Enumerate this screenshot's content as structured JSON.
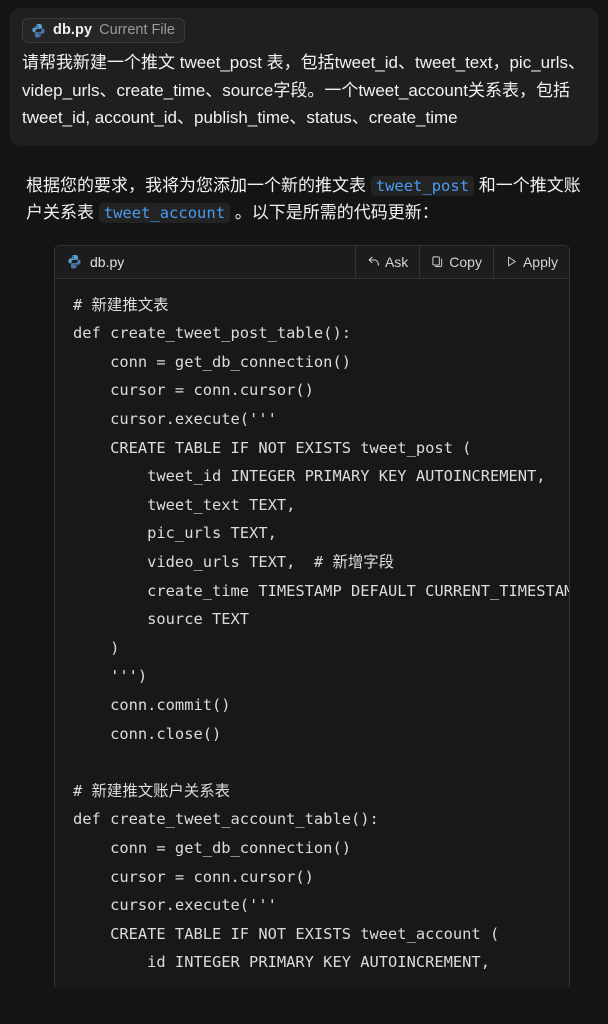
{
  "user_message": {
    "file_chip": {
      "icon": "python-file-icon",
      "filename": "db.py",
      "context_label": "Current File"
    },
    "text": "请帮我新建一个推文 tweet_post 表，包括tweet_id、tweet_text，pic_urls、videp_urls、create_time、source字段。一个tweet_account关系表，包括tweet_id, account_id、publish_time、status、create_time"
  },
  "assistant_message": {
    "intro_part1": "根据您的要求，我将为您添加一个新的推文表",
    "inline_code_1": "tweet_post",
    "intro_part2": "和一个推文账户关系表",
    "inline_code_2": "tweet_account",
    "intro_part3": "。以下是所需的代码更新：",
    "code_block": {
      "icon": "python-file-icon",
      "filename": "db.py",
      "actions": [
        {
          "icon": "ask-arrow-icon",
          "label": "Ask"
        },
        {
          "icon": "copy-clipboard-icon",
          "label": "Copy"
        },
        {
          "icon": "apply-play-icon",
          "label": "Apply"
        }
      ],
      "language": "python",
      "lines": [
        "# 新建推文表",
        "def create_tweet_post_table():",
        "    conn = get_db_connection()",
        "    cursor = conn.cursor()",
        "    cursor.execute('''",
        "    CREATE TABLE IF NOT EXISTS tweet_post (",
        "        tweet_id INTEGER PRIMARY KEY AUTOINCREMENT,",
        "        tweet_text TEXT,",
        "        pic_urls TEXT,",
        "        video_urls TEXT,  # 新增字段",
        "        create_time TIMESTAMP DEFAULT CURRENT_TIMESTAMP,",
        "        source TEXT",
        "    )",
        "    ''')",
        "    conn.commit()",
        "    conn.close()",
        "",
        "# 新建推文账户关系表",
        "def create_tweet_account_table():",
        "    conn = get_db_connection()",
        "    cursor = conn.cursor()",
        "    cursor.execute('''",
        "    CREATE TABLE IF NOT EXISTS tweet_account (",
        "        id INTEGER PRIMARY KEY AUTOINCREMENT,"
      ]
    }
  },
  "colors": {
    "page_background": "#141414",
    "bubble_background": "#1f1f1f",
    "code_background": "#181818",
    "code_header_background": "#1c1c1c",
    "border": "#333333",
    "inline_code_accent": "#4a9bf0",
    "text_primary": "#f2f2f2",
    "text_muted": "#9a9a9a"
  }
}
